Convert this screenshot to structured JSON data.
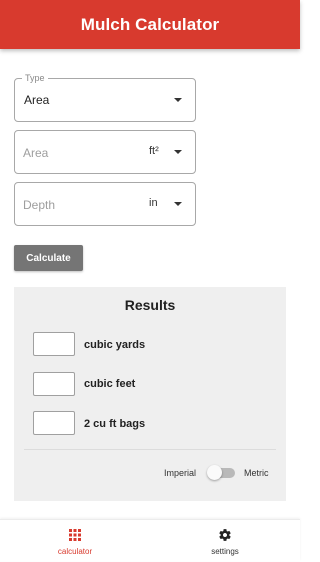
{
  "app_bar": {
    "title": "Mulch Calculator"
  },
  "form": {
    "type": {
      "label": "Type",
      "value": "Area"
    },
    "area": {
      "placeholder": "Area",
      "unit": "ft²"
    },
    "depth": {
      "placeholder": "Depth",
      "unit": "in"
    },
    "calculate_label": "Calculate"
  },
  "results": {
    "title": "Results",
    "rows": [
      {
        "value": "",
        "label": "cubic yards"
      },
      {
        "value": "",
        "label": "cubic feet"
      },
      {
        "value": "",
        "label": "2 cu ft bags"
      }
    ],
    "toggle": {
      "left_label": "Imperial",
      "right_label": "Metric",
      "selected": "Imperial"
    }
  },
  "bottom_nav": {
    "items": [
      {
        "label": "calculator",
        "icon": "grid-icon",
        "active": true
      },
      {
        "label": "settings",
        "icon": "gear-icon",
        "active": false
      }
    ]
  },
  "colors": {
    "primary": "#d83a2e",
    "button": "#757575",
    "results_background": "#efefef"
  }
}
